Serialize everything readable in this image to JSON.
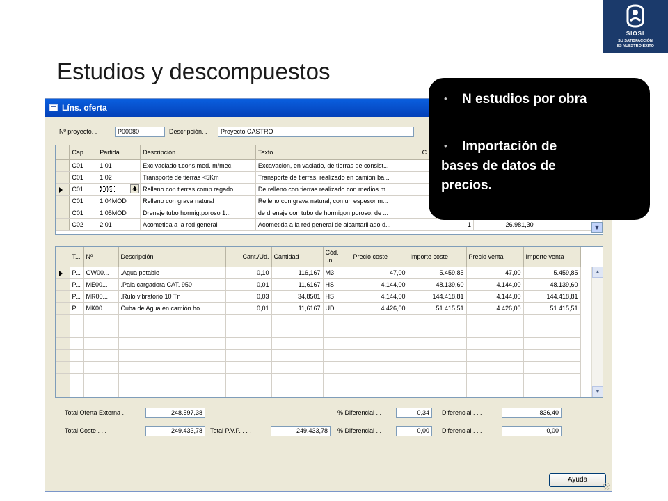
{
  "slide": {
    "title": "Estudios y descompuestos"
  },
  "logo": {
    "name": "SIOSI",
    "tagline_1": "SU SATISFACCIÓN",
    "tagline_2": "ES NUESTRO ÉXITO"
  },
  "window": {
    "title": "Líns. oferta"
  },
  "project": {
    "no_label": "Nº proyecto. .",
    "no_value": "P00080",
    "desc_label": "Descripción. .",
    "desc_value": "Proyecto CASTRO"
  },
  "lines_grid": {
    "headers": [
      "Cap...",
      "Partida",
      "Descripción",
      "Texto",
      "C"
    ],
    "rows": [
      [
        "C01",
        "1.01",
        "Exc.vaciado t.cons.med. m/mec.",
        "Excavacion, en vaciado, de tierras de consist..."
      ],
      [
        "C01",
        "1.02",
        "Transporte de tierras <5Km",
        "Transporte de tierras, realizado en camion ba..."
      ],
      [
        "C01",
        "1.03...",
        "Relleno con tierras comp.regado",
        "De relleno con tierras realizado con medios m..."
      ],
      [
        "C01",
        "1.04MOD",
        "Relleno con grava natural",
        "Relleno con grava natural, con un espesor m..."
      ],
      [
        "C01",
        "1.05MOD",
        "Drenaje tubo hormig.poroso 1...",
        "de drenaje con tubo de hormigon poroso, de ..."
      ],
      [
        "C02",
        "2.01",
        "Acometida a la red general",
        "Acometida a la red general de alcantarillado d...",
        "1",
        "26.981,30"
      ]
    ]
  },
  "components_grid": {
    "headers": [
      "T...",
      "Nº",
      "Descripción",
      "Cant./Ud.",
      "Cantidad",
      "Cód. uni...",
      "Precio coste",
      "Importe coste",
      "Precio venta",
      "Importe venta"
    ],
    "rows": [
      [
        "P...",
        "GW00...",
        ".Agua potable",
        "0,10",
        "116,167",
        "M3",
        "47,00",
        "5.459,85",
        "47,00",
        "5.459,85"
      ],
      [
        "P...",
        "ME00...",
        ".Pala cargadora CAT. 950",
        "0,01",
        "11,6167",
        "HS",
        "4.144,00",
        "48.139,60",
        "4.144,00",
        "48.139,60"
      ],
      [
        "P...",
        "MR00...",
        ".Rulo vibratorio 10 Tn",
        "0,03",
        "34,8501",
        "HS",
        "4.144,00",
        "144.418,81",
        "4.144,00",
        "144.418,81"
      ],
      [
        "P...",
        "MK00...",
        "Cuba de Agua en camión ho...",
        "0,01",
        "11,6167",
        "UD",
        "4.426,00",
        "51.415,51",
        "4.426,00",
        "51.415,51"
      ]
    ]
  },
  "totals": {
    "oferta_externa_label": "Total Oferta Externa .",
    "oferta_externa": "248.597,38",
    "pct_dif_label_1": "% Diferencial . .",
    "pct_dif_1": "0,34",
    "dif_label_1": "Diferencial . . .",
    "dif_1": "836,40",
    "coste_label": "Total Coste . . .",
    "coste": "249.433,78",
    "pvp_label": "Total P.V.P. . . .",
    "pvp": "249.433,78",
    "pct_dif_label_2": "% Diferencial . .",
    "pct_dif_2": "0,00",
    "dif_label_2": "Diferencial . . .",
    "dif_2": "0,00"
  },
  "buttons": {
    "ayuda": "Ayuda"
  },
  "callout": {
    "item_1": "N estudios por obra",
    "item_2_line_1": "Importación de",
    "item_2_line_2": "bases de datos de",
    "item_2_line_3": "precios."
  },
  "icons": {
    "logo": "person-face-icon",
    "bullet": "bullet-dot-icon",
    "scroll_up": "chevron-up-icon",
    "scroll_down": "chevron-down-icon"
  }
}
